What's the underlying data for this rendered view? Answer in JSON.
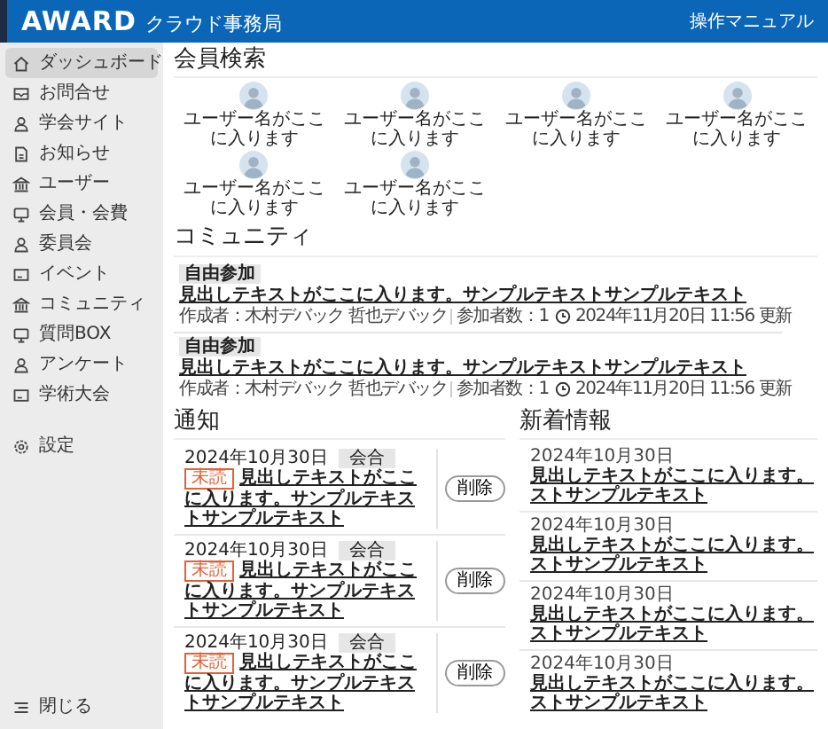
{
  "header": {
    "logo": "AWARD",
    "service_name": "クラウド事務局",
    "manual_link": "操作マニュアル"
  },
  "sidebar": {
    "items": [
      {
        "label": "ダッシュボード",
        "selected": true
      },
      {
        "label": "お問合せ",
        "selected": false
      },
      {
        "label": "学会サイト",
        "selected": false
      },
      {
        "label": "お知らせ",
        "selected": false
      },
      {
        "label": "ユーザー",
        "selected": false
      },
      {
        "label": "会員・会費",
        "selected": false
      },
      {
        "label": "委員会",
        "selected": false
      },
      {
        "label": "イベント",
        "selected": false
      },
      {
        "label": "コミュニティ",
        "selected": false
      },
      {
        "label": "質問BOX",
        "selected": false
      },
      {
        "label": "アンケート",
        "selected": false
      },
      {
        "label": "学術大会",
        "selected": false
      }
    ],
    "settings": {
      "label": "設定",
      "selected": false
    },
    "close": "閉じる"
  },
  "member_search": {
    "title": "会員検索",
    "members": [
      {
        "name": "ユーザー名がここに入ります"
      },
      {
        "name": "ユーザー名がここに入ります"
      },
      {
        "name": "ユーザー名がここに入ります"
      },
      {
        "name": "ユーザー名がここに入ります"
      },
      {
        "name": "ユーザー名がここに入ります"
      },
      {
        "name": "ユーザー名がここに入ります"
      }
    ]
  },
  "community": {
    "title": "コミュニティ",
    "posts": [
      {
        "tag": "自由参加",
        "headline": "見出しテキストがここに入ります。サンプルテキストサンプルテキスト",
        "author": "作成者：木村デバック 哲也デバック",
        "participants": "参加者数：1",
        "updated": "2024年11月20日 11:56 更新"
      },
      {
        "tag": "自由参加",
        "headline": "見出しテキストがここに入ります。サンプルテキストサンプルテキスト",
        "author": "作成者：木村デバック 哲也デバック",
        "participants": "参加者数：1",
        "updated": "2024年11月20日 11:56 更新"
      }
    ]
  },
  "notifications": {
    "title": "通知",
    "items": [
      {
        "date": "2024年10月30日",
        "tag": "会合",
        "badge": "未読",
        "headline": "見出しテキストがここに入ります。サンプルテキストサンプルテキスト",
        "delete_button": "削除"
      },
      {
        "date": "2024年10月30日",
        "tag": "会合",
        "badge": "未読",
        "headline": "見出しテキストがここに入ります。サンプルテキストサンプルテキスト",
        "delete_button": "削除"
      },
      {
        "date": "2024年10月30日",
        "tag": "会合",
        "badge": "未読",
        "headline": "見出しテキストがここに入ります。サンプルテキストサンプルテキスト",
        "delete_button": "削除"
      }
    ]
  },
  "news": {
    "title": "新着情報",
    "items": [
      {
        "date": "2024年10月30日",
        "headline_lines": [
          "見出しテキストがここに入ります。",
          "ストサンプルテキスト"
        ]
      },
      {
        "date": "2024年10月30日",
        "headline_lines": [
          "見出しテキストがここに入ります。",
          "ストサンプルテキスト"
        ]
      },
      {
        "date": "2024年10月30日",
        "headline_lines": [
          "見出しテキストがここに入ります。",
          "ストサンプルテキスト"
        ]
      },
      {
        "date": "2024年10月30日",
        "headline_lines": [
          "見出しテキストがここに入ります。",
          "ストサンプルテキスト"
        ]
      }
    ]
  }
}
